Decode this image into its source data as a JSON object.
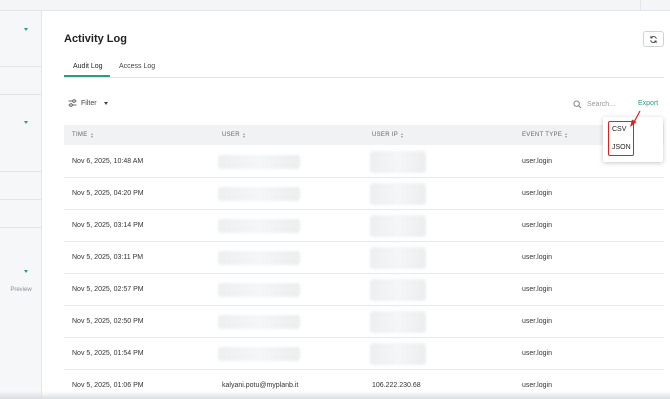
{
  "sidebar": {
    "preview_label": "Preview"
  },
  "header": {
    "title": "Activity Log"
  },
  "tabs": [
    {
      "label": "Audit Log"
    },
    {
      "label": "Access Log"
    }
  ],
  "toolbar": {
    "filter_label": "Filter",
    "search_placeholder": "Search...",
    "export_label": "Export"
  },
  "export_menu": {
    "items": [
      {
        "label": "CSV"
      },
      {
        "label": "JSON"
      }
    ]
  },
  "table": {
    "columns": [
      {
        "label": "TIME"
      },
      {
        "label": "USER"
      },
      {
        "label": "USER IP"
      },
      {
        "label": "EVENT TYPE"
      }
    ],
    "rows": [
      {
        "time": "Nov 6, 2025, 10:48 AM",
        "user": "",
        "ip": "",
        "event": "user.login"
      },
      {
        "time": "Nov 5, 2025, 04:20 PM",
        "user": "",
        "ip": "",
        "event": "user.login"
      },
      {
        "time": "Nov 5, 2025, 03:14 PM",
        "user": "",
        "ip": "",
        "event": "user.login"
      },
      {
        "time": "Nov 5, 2025, 03:11 PM",
        "user": "",
        "ip": "",
        "event": "user.login"
      },
      {
        "time": "Nov 5, 2025, 02:57 PM",
        "user": "",
        "ip": "",
        "event": "user.login"
      },
      {
        "time": "Nov 5, 2025, 02:50 PM",
        "user": "",
        "ip": "",
        "event": "user.login"
      },
      {
        "time": "Nov 5, 2025, 01:54 PM",
        "user": "",
        "ip": "",
        "event": "user.login"
      },
      {
        "time": "Nov 5, 2025, 01:06 PM",
        "user": "kalyani.potu@myplanb.it",
        "ip": "106.222.230.68",
        "event": "user.login"
      }
    ]
  },
  "colors": {
    "accent": "#2e9a86",
    "highlight_box": "#e02020"
  }
}
